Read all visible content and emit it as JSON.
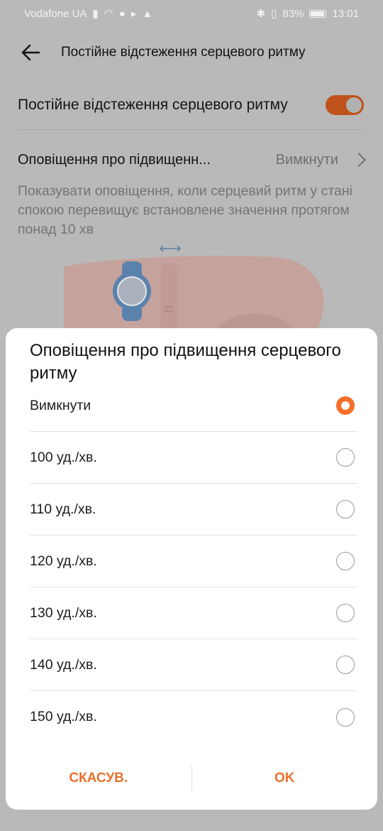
{
  "status_bar": {
    "carrier": "Vodafone UA",
    "battery": "83%",
    "time": "13:01",
    "icons": [
      "signal-icon",
      "wifi-icon",
      "spotify-icon",
      "twitter-icon",
      "navigation-icon",
      "bluetooth-icon",
      "vibrate-icon",
      "battery-icon"
    ]
  },
  "header": {
    "title": "Постійне відстеження серцевого ритму"
  },
  "settings": {
    "continuous": {
      "label": "Постійне відстеження серцевого ритму",
      "enabled": true
    },
    "alert": {
      "label": "Оповіщення про підвищенн...",
      "value": "Вимкнути"
    },
    "description": "Показувати оповіщення, коли серцевий ритм у стані спокою перевищує встановлене значення протягом понад 10 хв"
  },
  "dialog": {
    "title": "Оповіщення про підвищення серцевого ритму",
    "options": [
      {
        "label": "Вимкнути",
        "selected": true
      },
      {
        "label": "100 уд./хв.",
        "selected": false
      },
      {
        "label": "110 уд./хв.",
        "selected": false
      },
      {
        "label": "120 уд./хв.",
        "selected": false
      },
      {
        "label": "130 уд./хв.",
        "selected": false
      },
      {
        "label": "140 уд./хв.",
        "selected": false
      },
      {
        "label": "150 уд./хв.",
        "selected": false
      }
    ],
    "cancel_label": "СКАСУВ.",
    "ok_label": "OK"
  },
  "colors": {
    "accent": "#f46f28",
    "toggle": "#c0521c",
    "overlay": "#b9b9b9"
  }
}
